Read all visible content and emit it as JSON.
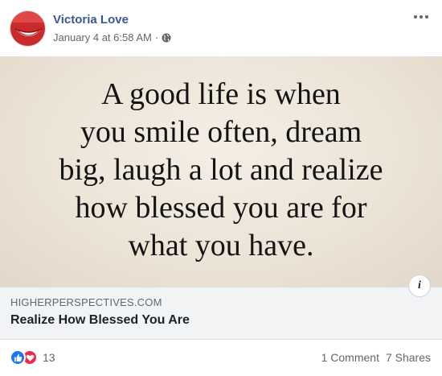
{
  "post": {
    "author": "Victoria Love",
    "timestamp": "January 4 at 6:58 AM",
    "separator": "·",
    "privacy_icon": "globe-icon",
    "more_icon": "more-options-icon"
  },
  "link_preview": {
    "image_text": "A good life is when you smile often, dream big, laugh a lot and realize how blessed you are for what you have.",
    "image_lines": [
      "A good life is when",
      "you smile often, dream",
      "big, laugh a lot and realize",
      "how blessed you are for",
      "what you have."
    ],
    "info_icon": "info-icon",
    "info_label": "i",
    "domain": "HIGHERPERSPECTIVES.COM",
    "title": "Realize How Blessed You Are"
  },
  "engagement": {
    "reaction_icons": [
      "like-icon",
      "love-icon"
    ],
    "reaction_count": "13",
    "comments": "1 Comment",
    "shares": "7 Shares"
  },
  "colors": {
    "author_link": "#385898",
    "like": "#1877f2",
    "love": "#f0284a",
    "caption_bg": "#f2f3f5"
  }
}
